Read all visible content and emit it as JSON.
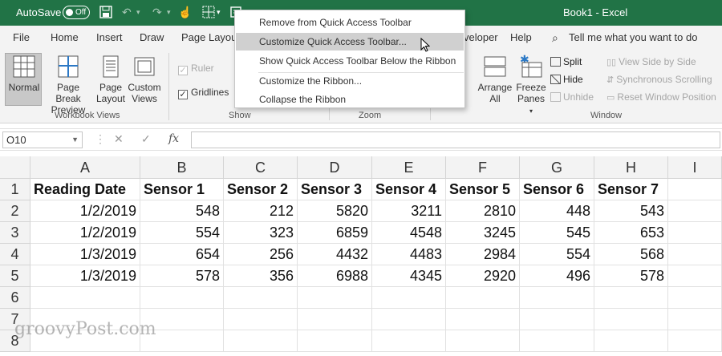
{
  "titlebar": {
    "autosave": "AutoSave",
    "toggle": "Off",
    "doc_title": "Book1  -  Excel"
  },
  "tabs": [
    "File",
    "Home",
    "Insert",
    "Draw",
    "Page Layou",
    "veloper",
    "Help"
  ],
  "tellme": "Tell me what you want to do",
  "ribbon": {
    "normal": "Normal",
    "page_break": "Page Break",
    "page_break2": "Preview",
    "page_layout": "Page",
    "page_layout2": "Layout",
    "custom_views": "Custom",
    "custom_views2": "Views",
    "group_workbook": "Workbook Views",
    "ruler": "Ruler",
    "gridlines": "Gridlines",
    "group_show": "Show",
    "group_zoom": "Zoom",
    "w_partial": "w",
    "arrange": "Arrange",
    "arrange2": "All",
    "freeze": "Freeze",
    "freeze2": "Panes",
    "split": "Split",
    "hide": "Hide",
    "unhide": "Unhide",
    "side_by_side": "View Side by Side",
    "sync_scroll": "Synchronous Scrolling",
    "reset_pos": "Reset Window Position",
    "group_window": "Window"
  },
  "menu": {
    "items": [
      "Remove from Quick Access Toolbar",
      "Customize Quick Access Toolbar...",
      "Show Quick Access Toolbar Below the Ribbon",
      "Customize the Ribbon...",
      "Collapse the Ribbon"
    ]
  },
  "formula": {
    "namebox": "O10",
    "value": ""
  },
  "sheet": {
    "columns": [
      "A",
      "B",
      "C",
      "D",
      "E",
      "F",
      "G",
      "H",
      "I"
    ],
    "rows": [
      "1",
      "2",
      "3",
      "4",
      "5",
      "6",
      "7",
      "8"
    ],
    "header": [
      "Reading Date",
      "Sensor 1",
      "Sensor 2",
      "Sensor 3",
      "Sensor 4",
      "Sensor 5",
      "Sensor 6",
      "Sensor 7"
    ],
    "data": [
      [
        "1/2/2019",
        "548",
        "212",
        "5820",
        "3211",
        "2810",
        "448",
        "543"
      ],
      [
        "1/2/2019",
        "554",
        "323",
        "6859",
        "4548",
        "3245",
        "545",
        "653"
      ],
      [
        "1/3/2019",
        "654",
        "256",
        "4432",
        "4483",
        "2984",
        "554",
        "568"
      ],
      [
        "1/3/2019",
        "578",
        "356",
        "6988",
        "4345",
        "2920",
        "496",
        "578"
      ]
    ]
  },
  "watermark": "groovyPost.com"
}
